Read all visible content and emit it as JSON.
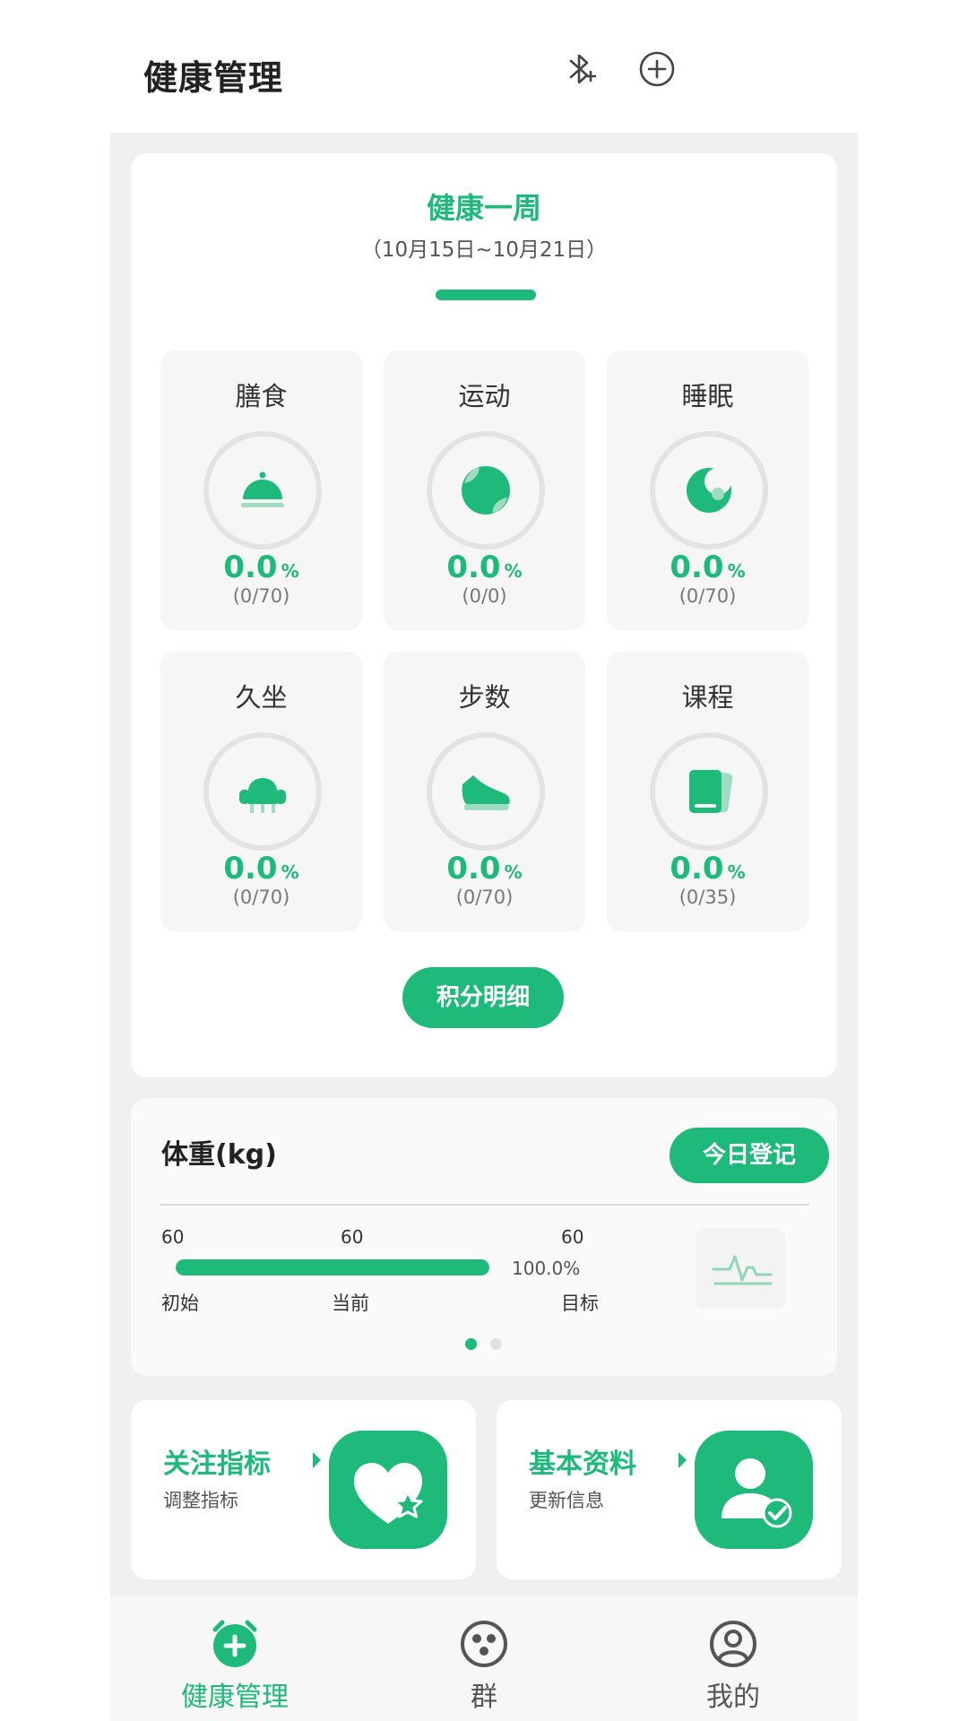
{
  "header": {
    "title": "健康管理",
    "bluetooth_icon": "bluetooth-add-icon",
    "add_icon": "plus-circle-icon"
  },
  "week": {
    "title": "健康一周",
    "range": "（10月15日~10月21日）",
    "tiles": [
      {
        "name": "膳食",
        "icon": "cloche-icon",
        "percent": "0.0",
        "unit": "%",
        "ratio": "(0/70)"
      },
      {
        "name": "运动",
        "icon": "ball-icon",
        "percent": "0.0",
        "unit": "%",
        "ratio": "(0/0)"
      },
      {
        "name": "睡眠",
        "icon": "moon-icon",
        "percent": "0.0",
        "unit": "%",
        "ratio": "(0/70)"
      },
      {
        "name": "久坐",
        "icon": "armchair-icon",
        "percent": "0.0",
        "unit": "%",
        "ratio": "(0/70)"
      },
      {
        "name": "步数",
        "icon": "shoe-icon",
        "percent": "0.0",
        "unit": "%",
        "ratio": "(0/70)"
      },
      {
        "name": "课程",
        "icon": "book-icon",
        "percent": "0.0",
        "unit": "%",
        "ratio": "(0/35)"
      }
    ],
    "points_button": "积分明细"
  },
  "weight": {
    "title": "体重(kg)",
    "register_button": "今日登记",
    "initial_value": "60",
    "current_value": "60",
    "target_value": "60",
    "initial_label": "初始",
    "current_label": "当前",
    "target_label": "目标",
    "progress_text": "100.0%",
    "progress": 1.0,
    "pager": {
      "count": 2,
      "active": 0
    }
  },
  "shortcuts": [
    {
      "title": "关注指标",
      "subtitle": "调整指标",
      "icon": "heart-star-icon"
    },
    {
      "title": "基本资料",
      "subtitle": "更新信息",
      "icon": "user-check-icon"
    }
  ],
  "tabbar": [
    {
      "label": "健康管理",
      "icon": "alarm-plus-icon",
      "active": true
    },
    {
      "label": "群",
      "icon": "group-icon",
      "active": false
    },
    {
      "label": "我的",
      "icon": "profile-icon",
      "active": false
    }
  ],
  "colors": {
    "accent": "#1dba79",
    "accent_light": "#9fdcc1",
    "text": "#222222",
    "muted": "#777777",
    "background": "#eff1f1",
    "inactive_tab": "#555555"
  }
}
